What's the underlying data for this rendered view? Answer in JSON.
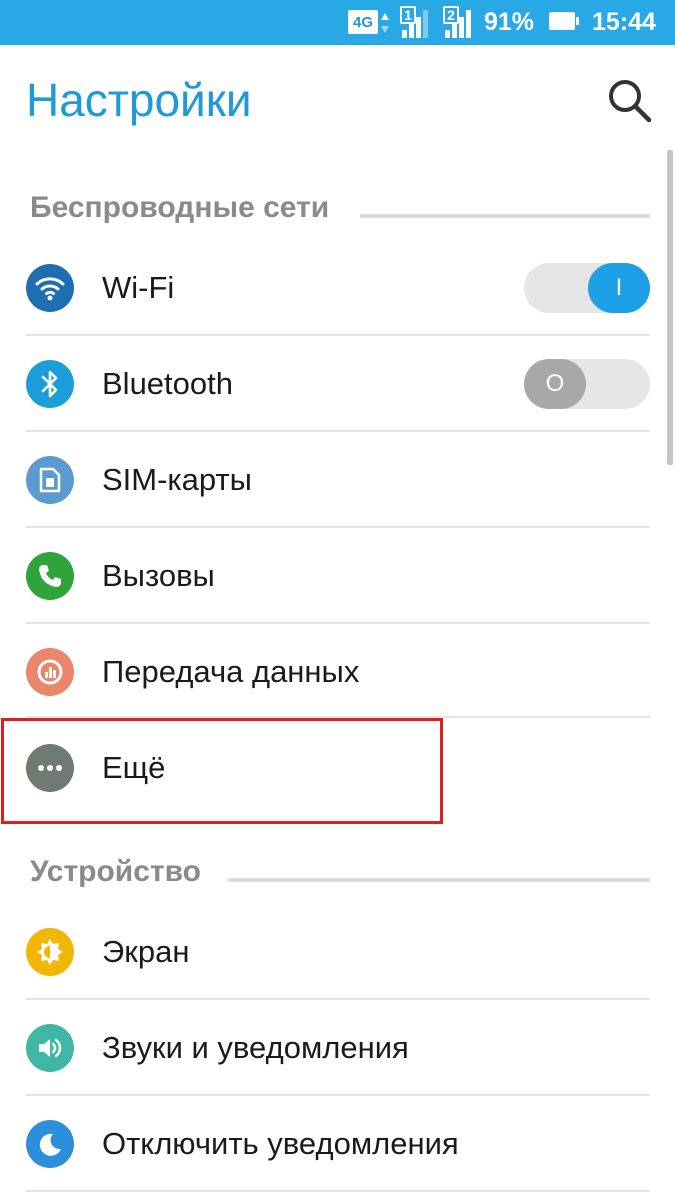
{
  "status_bar": {
    "network_type": "4G",
    "sim1_label": "1",
    "sim2_label": "2",
    "battery_percent": "91%",
    "time": "15:44"
  },
  "header": {
    "title": "Настройки",
    "search_icon": "search-icon"
  },
  "sections": [
    {
      "title": "Беспроводные сети",
      "items": [
        {
          "label": "Wi-Fi",
          "icon": "wifi-icon",
          "icon_color": "#1f6fb0",
          "toggle": "on",
          "toggle_text": "I"
        },
        {
          "label": "Bluetooth",
          "icon": "bluetooth-icon",
          "icon_color": "#1b9ed8",
          "toggle": "off",
          "toggle_text": "O"
        },
        {
          "label": "SIM-карты",
          "icon": "sim-card-icon",
          "icon_color": "#5c9ad0"
        },
        {
          "label": "Вызовы",
          "icon": "phone-icon",
          "icon_color": "#2ea43a"
        },
        {
          "label": "Передача данных",
          "icon": "data-usage-icon",
          "icon_color": "#e8876a"
        },
        {
          "label": "Ещё",
          "icon": "more-icon",
          "icon_color": "#6f7a72"
        }
      ]
    },
    {
      "title": "Устройство",
      "items": [
        {
          "label": "Экран",
          "icon": "brightness-icon",
          "icon_color": "#f2b705"
        },
        {
          "label": "Звуки и уведомления",
          "icon": "volume-icon",
          "icon_color": "#3fb6a6"
        },
        {
          "label": "Отключить уведомления",
          "icon": "moon-icon",
          "icon_color": "#2d8fdc"
        }
      ]
    }
  ],
  "colors": {
    "status_bar": "#29a8e6",
    "title": "#1e9ad6",
    "toggle_on": "#1ea0e6",
    "toggle_off": "#a8a8a8",
    "highlight": "#e01e1e"
  }
}
